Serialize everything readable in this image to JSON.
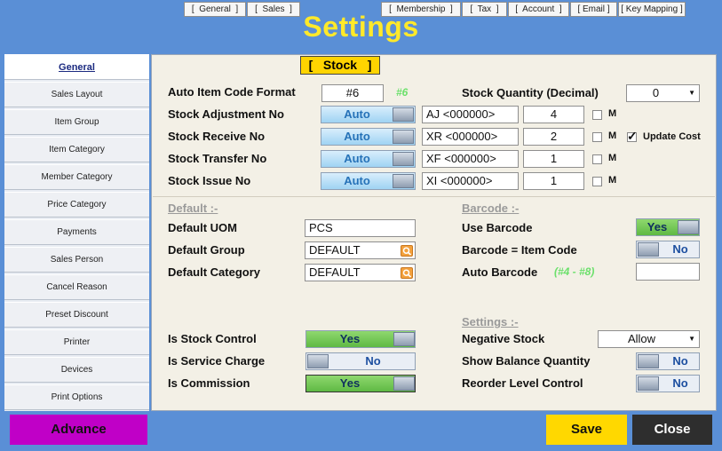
{
  "window": {
    "title": "Settings"
  },
  "sidebar": {
    "items": [
      {
        "label": "General",
        "active": true
      },
      {
        "label": "Sales Layout"
      },
      {
        "label": "Item Group"
      },
      {
        "label": "Item Category"
      },
      {
        "label": "Member Category"
      },
      {
        "label": "Price Category"
      },
      {
        "label": "Payments"
      },
      {
        "label": "Sales Person"
      },
      {
        "label": "Cancel Reason"
      },
      {
        "label": "Preset Discount"
      },
      {
        "label": "Printer"
      },
      {
        "label": "Devices"
      },
      {
        "label": "Print Options"
      }
    ]
  },
  "tabs": [
    {
      "label": "[  General  ]"
    },
    {
      "label": "[  Sales  ]"
    },
    {
      "label": "[   Stock   ]",
      "active": true
    },
    {
      "label": "[  Membership  ]"
    },
    {
      "label": "[  Tax  ]"
    },
    {
      "label": "[  Account  ]"
    },
    {
      "label": "[ Email ]"
    },
    {
      "label": "[ Key Mapping ]"
    }
  ],
  "stock": {
    "auto_item_code": {
      "label": "Auto Item Code Format",
      "value": "#6",
      "hint": "#6"
    },
    "stock_quantity": {
      "label": "Stock Quantity (Decimal)",
      "value": "0"
    },
    "rows": [
      {
        "label": "Stock Adjustment No",
        "mode": "Auto",
        "prefix": "AJ <000000>",
        "digits": "4",
        "m": "M"
      },
      {
        "label": "Stock Receive No",
        "mode": "Auto",
        "prefix": "XR <000000>",
        "digits": "2",
        "m": "M"
      },
      {
        "label": "Stock Transfer No",
        "mode": "Auto",
        "prefix": "XF <000000>",
        "digits": "1",
        "m": "M"
      },
      {
        "label": "Stock Issue No",
        "mode": "Auto",
        "prefix": "XI <000000>",
        "digits": "1",
        "m": "M"
      }
    ],
    "update_cost": {
      "label": "Update Cost",
      "checked": true,
      "mark": "✓"
    }
  },
  "defaults": {
    "section": "Default :-",
    "uom": {
      "label": "Default UOM",
      "value": "PCS"
    },
    "group": {
      "label": "Default Group",
      "value": "DEFAULT"
    },
    "category": {
      "label": "Default Category",
      "value": "DEFAULT"
    }
  },
  "barcode": {
    "section": "Barcode :-",
    "use_barcode": {
      "label": "Use Barcode",
      "value": "Yes"
    },
    "barcode_item_code": {
      "label": "Barcode = Item Code",
      "value": "No"
    },
    "auto_barcode": {
      "label": "Auto Barcode",
      "hint": "(#4 - #8)",
      "value": ""
    }
  },
  "flags": {
    "stock_control": {
      "label": "Is Stock Control",
      "value": "Yes"
    },
    "service_charge": {
      "label": "Is Service Charge",
      "value": "No"
    },
    "commission": {
      "label": "Is Commission",
      "value": "Yes"
    }
  },
  "settings": {
    "section": "Settings :-",
    "negative_stock": {
      "label": "Negative Stock",
      "value": "Allow"
    },
    "show_balance_qty": {
      "label": "Show Balance Quantity",
      "value": "No"
    },
    "reorder_level": {
      "label": "Reorder Level Control",
      "value": "No"
    }
  },
  "footer": {
    "advance": "Advance",
    "save": "Save",
    "close": "Close"
  },
  "colors": {
    "frame": "#5a8fd6",
    "title": "#ffe92a",
    "advance": "#c000c7",
    "save": "#ffd800",
    "close": "#2e2e2e"
  }
}
